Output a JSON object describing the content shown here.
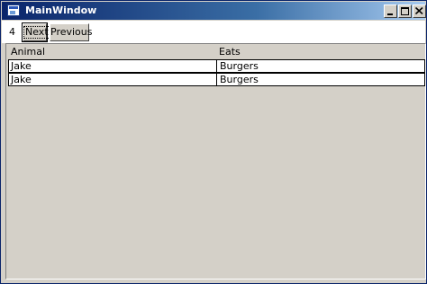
{
  "window": {
    "title": "MainWindow",
    "icon": "app-window-icon"
  },
  "toolbar": {
    "counter": "4",
    "next_label": "Next",
    "previous_label": "Previous"
  },
  "grid": {
    "columns": [
      "Animal",
      "Eats"
    ],
    "rows": [
      [
        "Jake",
        "Burgers"
      ],
      [
        "Jake",
        "Burgers"
      ]
    ]
  }
}
